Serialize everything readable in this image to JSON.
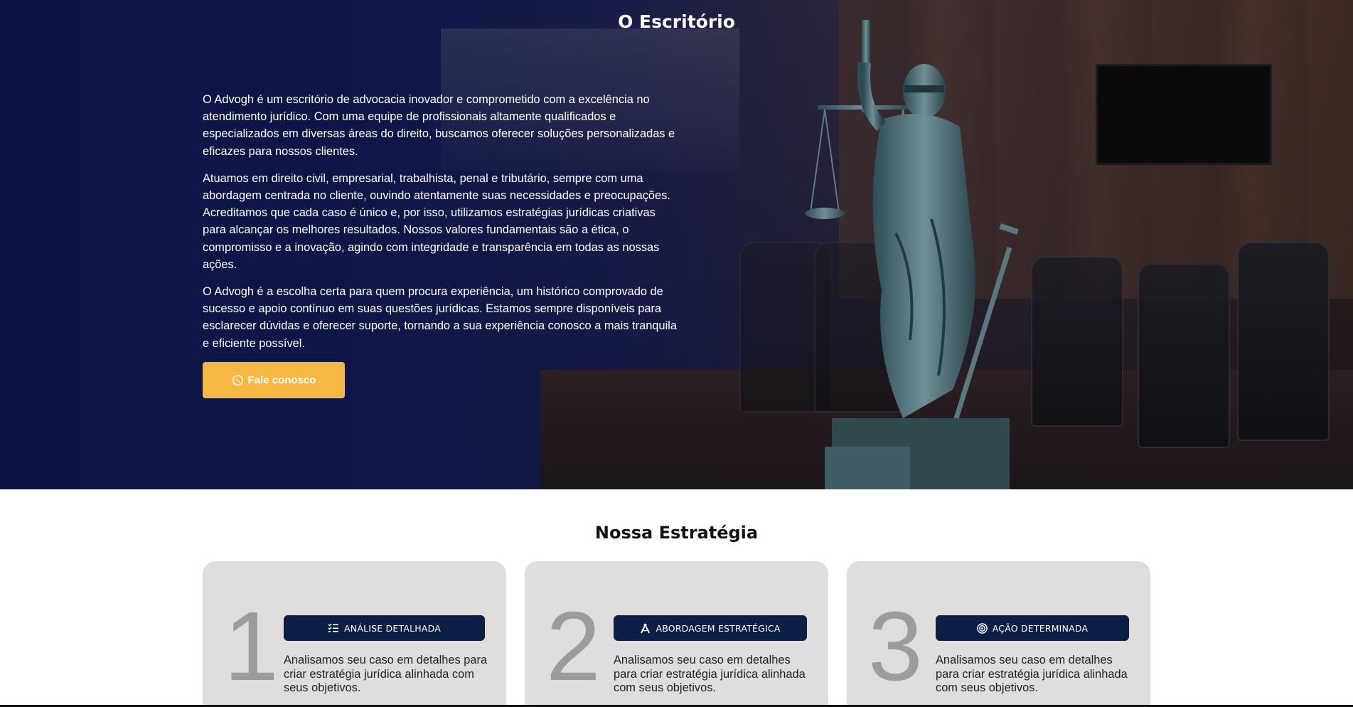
{
  "hero": {
    "title": "O Escritório",
    "paragraphs": [
      "O Advogh é um escritório de advocacia inovador e comprometido com a excelência no atendimento jurídico. Com uma equipe de profissionais altamente qualificados e especializados em diversas áreas do direito, buscamos oferecer soluções personalizadas e eficazes para nossos clientes.",
      "Atuamos em direito civil, empresarial, trabalhista, penal e tributário, sempre com uma abordagem centrada no cliente, ouvindo atentamente suas necessidades e preocupações. Acreditamos que cada caso é único e, por isso, utilizamos estratégias jurídicas criativas para alcançar os melhores resultados. Nossos valores fundamentais são a ética, o compromisso e a inovação, agindo com integridade e transparência em todas as nossas ações.",
      "O Advogh é a escolha certa para quem procura experiência, um histórico comprovado de sucesso e apoio contínuo em suas questões jurídicas. Estamos sempre disponíveis para esclarecer dúvidas e oferecer suporte, tornando a sua experiência conosco a mais tranquila e eficiente possível."
    ],
    "cta_label": "Fale conosco",
    "cta_icon": "whatsapp-icon"
  },
  "strategy": {
    "title": "Nossa Estratégia",
    "cards": [
      {
        "number": "1",
        "badge": "ANÁLISE DETALHADA",
        "icon": "checklist-icon",
        "description": "Analisamos seu caso em detalhes para criar estratégia jurídica alinhada com seus objetivos."
      },
      {
        "number": "2",
        "badge": "ABORDAGEM ESTRATÉGICA",
        "icon": "compass-icon",
        "description": "Analisamos seu caso em detalhes para criar estratégia jurídica alinhada com seus objetivos."
      },
      {
        "number": "3",
        "badge": "AÇÃO DETERMINADA",
        "icon": "target-icon",
        "description": "Analisamos seu caso em detalhes para criar estratégia jurídica alinhada com seus objetivos."
      }
    ]
  },
  "colors": {
    "accent": "#f7b843",
    "navy": "#0d1f45",
    "card_bg": "#e0dedd"
  }
}
